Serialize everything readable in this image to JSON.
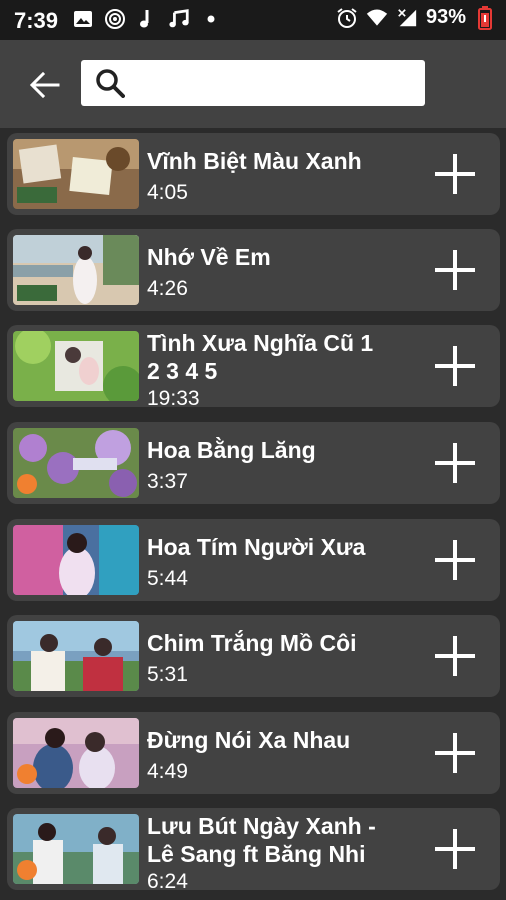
{
  "status_bar": {
    "time": "7:39",
    "battery": "93%",
    "left_icons": [
      "image-icon",
      "radio-icon",
      "music-note-icon",
      "music-notes-icon",
      "dot-icon"
    ],
    "right_icons": [
      "alarm-icon",
      "wifi-icon",
      "signal-icon",
      "battery-icon"
    ]
  },
  "toolbar": {
    "back_icon": "arrow-left-icon",
    "search_placeholder": "",
    "search_value": ""
  },
  "songs": [
    {
      "title": "Vĩnh Biệt Màu Xanh",
      "duration": "4:05"
    },
    {
      "title": "Nhớ Về Em",
      "duration": "4:26"
    },
    {
      "title": "Tình Xưa Nghĩa Cũ 1 2 3 4 5",
      "duration": "19:33"
    },
    {
      "title": "Hoa Bằng Lăng",
      "duration": "3:37"
    },
    {
      "title": "Hoa Tím Người Xưa",
      "duration": "5:44"
    },
    {
      "title": "Chim Trắng Mồ Côi",
      "duration": "5:31"
    },
    {
      "title": "Đừng Nói Xa Nhau",
      "duration": "4:49"
    },
    {
      "title": "Lưu Bút Ngày Xanh - Lê Sang ft Băng Nhi",
      "duration": "6:24"
    }
  ],
  "add_icon": "plus-icon",
  "colors": {
    "background": "#2b2b2b",
    "card": "#424242",
    "status_bar": "#1a1a1a",
    "accent_battery": "#e53935"
  }
}
